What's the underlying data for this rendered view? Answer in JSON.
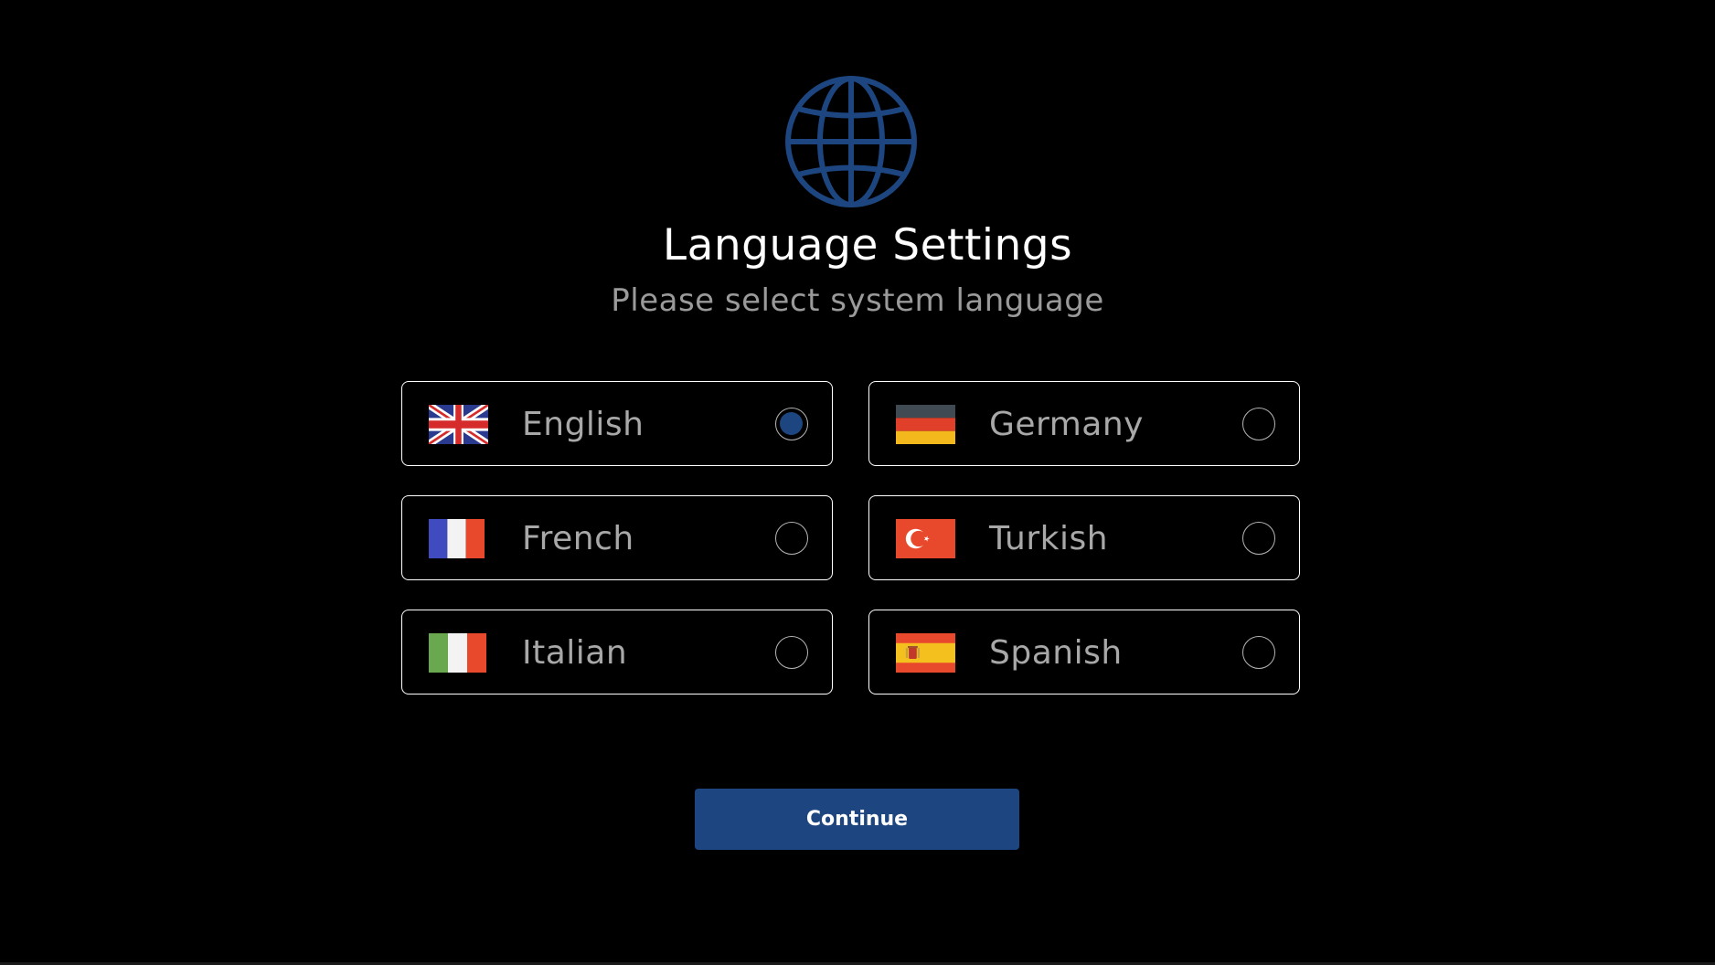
{
  "header": {
    "icon": "globe-icon",
    "title": "Language Settings",
    "subtitle": "Please select system language"
  },
  "languages": [
    {
      "label": "English",
      "flag": "uk-flag-icon",
      "selected": true
    },
    {
      "label": "Germany",
      "flag": "germany-flag-icon",
      "selected": false
    },
    {
      "label": "French",
      "flag": "france-flag-icon",
      "selected": false
    },
    {
      "label": "Turkish",
      "flag": "turkey-flag-icon",
      "selected": false
    },
    {
      "label": "Italian",
      "flag": "italy-flag-icon",
      "selected": false
    },
    {
      "label": "Spanish",
      "flag": "spain-flag-icon",
      "selected": false
    }
  ],
  "actions": {
    "continue_label": "Continue"
  },
  "colors": {
    "background": "#000000",
    "accent": "#1d4680",
    "title_text": "#ffffff",
    "muted_text": "#9a9a9a",
    "card_border": "#ffffff"
  }
}
